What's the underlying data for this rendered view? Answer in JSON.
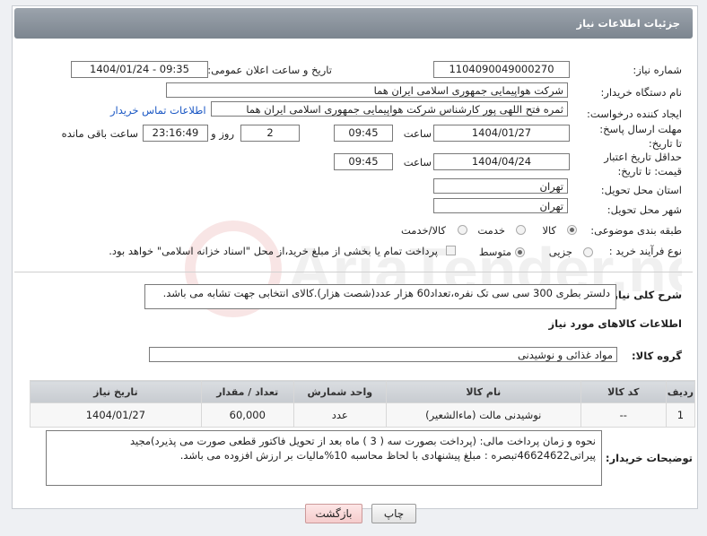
{
  "header": {
    "title": "جزئیات اطلاعات نیاز"
  },
  "form": {
    "need_number_label": "شماره نیاز:",
    "need_number": "1104090049000270",
    "announce_label": "تاریخ و ساعت اعلان عمومی:",
    "announce_value": "1404/01/24 - 09:35",
    "buyer_org_label": "نام دستگاه خریدار:",
    "buyer_org": "شرکت هواپیمایی جمهوری اسلامی ایران هما",
    "creator_label": "ایجاد کننده درخواست:",
    "creator": "ثمره فتح اللهی پور کارشناس شرکت هواپیمایی جمهوری اسلامی ایران هما",
    "contact_link": "اطلاعات تماس خریدار",
    "deadline_label": "مهلت ارسال پاسخ: تا تاریخ:",
    "deadline_date": "1404/01/27",
    "time_word": "ساعت",
    "deadline_time": "09:45",
    "days": "2",
    "days_word": "روز و",
    "remaining_time": "23:16:49",
    "remaining_word": "ساعت باقی مانده",
    "validity_label": "حداقل تاریخ اعتبار قیمت: تا تاریخ:",
    "validity_date": "1404/04/24",
    "validity_time": "09:45",
    "province_label": "استان محل تحویل:",
    "province": "تهران",
    "city_label": "شهر محل تحویل:",
    "city": "تهران",
    "category_label": "طبقه بندی موضوعی:",
    "category_options": [
      "کالا",
      "خدمت",
      "کالا/خدمت"
    ],
    "process_label": "نوع فرآیند خرید :",
    "process_options": [
      "جزیی",
      "متوسط"
    ],
    "treasury_note": "پرداخت تمام یا بخشی از مبلغ خرید،از محل \"اسناد خزانه اسلامی\" خواهد بود.",
    "description_label": "شرح کلی نیاز:",
    "description": "دلستر بطری 300 سی سی تک نفره،تعداد60  هزار عدد(شصت هزار).کالای انتخابی جهت تشابه می باشد.",
    "goods_info_title": "اطلاعات کالاهای مورد نیاز",
    "goods_group_label": "گروه کالا:",
    "goods_group": "مواد غذائی و نوشیدنی"
  },
  "table": {
    "headers": [
      "ردیف",
      "کد کالا",
      "نام کالا",
      "واحد شمارش",
      "تعداد / مقدار",
      "تاریخ نیاز"
    ],
    "rows": [
      {
        "row": "1",
        "code": "--",
        "name": "نوشیدنی مالت (ماءالشعیر)",
        "unit": "عدد",
        "qty": "60,000",
        "date": "1404/01/27"
      }
    ]
  },
  "buyer_notes": {
    "label": "توضیحات خریدار:",
    "line1": "نحوه و زمان پرداخت مالی:  (پرداخت بصورت سه ( 3 ) ماه بعد از تحویل فاکتور قطعی  صورت می پذیرد)مجید",
    "line2": "پیراتی46624622تبصره : مبلغ پیشنهادی با لحاظ محاسبه 10%مالیات بر ارزش افزوده می باشد."
  },
  "buttons": {
    "print": "چاپ",
    "back": "بازگشت"
  },
  "watermark": "AriaTender.neT"
}
